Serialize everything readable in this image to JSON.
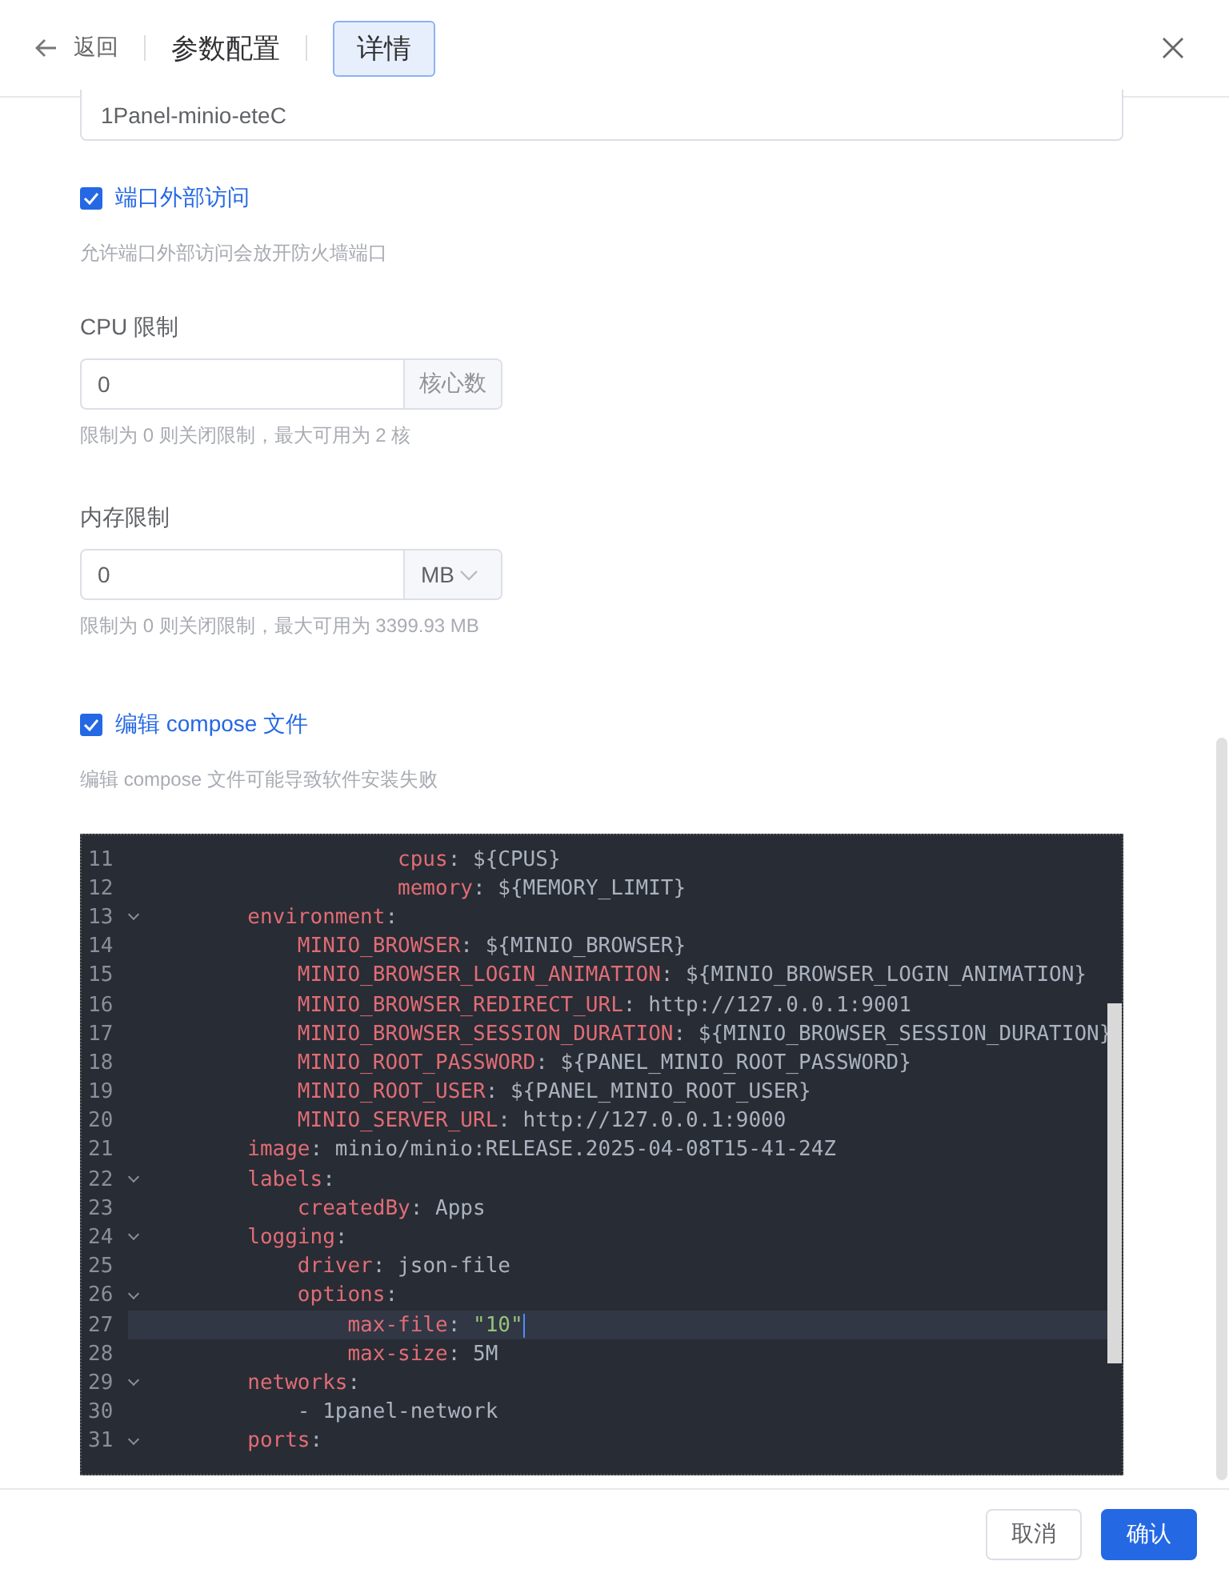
{
  "header": {
    "back": "返回",
    "tabs": [
      {
        "label": "参数配置",
        "selected": false
      },
      {
        "label": "详情",
        "selected": true
      }
    ]
  },
  "container_name": {
    "value": "1Panel-minio-eteC"
  },
  "port_access": {
    "label": "端口外部访问",
    "checked": true,
    "hint": "允许端口外部访问会放开防火墙端口"
  },
  "cpu": {
    "label": "CPU 限制",
    "value": "0",
    "unit": "核心数",
    "kind": "text",
    "hint": "限制为 0 则关闭限制，最大可用为 2 核"
  },
  "memory": {
    "label": "内存限制",
    "value": "0",
    "unit": "MB",
    "kind": "select",
    "hint": "限制为 0 则关闭限制，最大可用为 3399.93 MB"
  },
  "edit_compose": {
    "label": "编辑 compose 文件",
    "checked": true,
    "hint": "编辑 compose 文件可能导致软件安装失败"
  },
  "editor": {
    "lines": [
      {
        "no": "11",
        "fold": false,
        "current": false,
        "key": "                    cpus",
        "value": ": ${CPUS}",
        "kind": "plain"
      },
      {
        "no": "12",
        "fold": false,
        "current": false,
        "key": "                    memory",
        "value": ": ${MEMORY_LIMIT}",
        "kind": "plain"
      },
      {
        "no": "13",
        "fold": true,
        "current": false,
        "key": "        environment",
        "value": ":",
        "kind": "plain"
      },
      {
        "no": "14",
        "fold": false,
        "current": false,
        "key": "            MINIO_BROWSER",
        "value": ": ${MINIO_BROWSER}",
        "kind": "plain"
      },
      {
        "no": "15",
        "fold": false,
        "current": false,
        "key": "            MINIO_BROWSER_LOGIN_ANIMATION",
        "value": ": ${MINIO_BROWSER_LOGIN_ANIMATION}",
        "kind": "plain"
      },
      {
        "no": "16",
        "fold": false,
        "current": false,
        "key": "            MINIO_BROWSER_REDIRECT_URL",
        "value": ": http://127.0.0.1:9001",
        "kind": "plain"
      },
      {
        "no": "17",
        "fold": false,
        "current": false,
        "key": "            MINIO_BROWSER_SESSION_DURATION",
        "value": ": ${MINIO_BROWSER_SESSION_DURATION}",
        "kind": "plain"
      },
      {
        "no": "18",
        "fold": false,
        "current": false,
        "key": "            MINIO_ROOT_PASSWORD",
        "value": ": ${PANEL_MINIO_ROOT_PASSWORD}",
        "kind": "plain"
      },
      {
        "no": "19",
        "fold": false,
        "current": false,
        "key": "            MINIO_ROOT_USER",
        "value": ": ${PANEL_MINIO_ROOT_USER}",
        "kind": "plain"
      },
      {
        "no": "20",
        "fold": false,
        "current": false,
        "key": "            MINIO_SERVER_URL",
        "value": ": http://127.0.0.1:9000",
        "kind": "plain"
      },
      {
        "no": "21",
        "fold": false,
        "current": false,
        "key": "        image",
        "value": ": minio/minio:RELEASE.2025-04-08T15-41-24Z",
        "kind": "plain"
      },
      {
        "no": "22",
        "fold": true,
        "current": false,
        "key": "        labels",
        "value": ":",
        "kind": "plain"
      },
      {
        "no": "23",
        "fold": false,
        "current": false,
        "key": "            createdBy",
        "value": ": Apps",
        "kind": "plain"
      },
      {
        "no": "24",
        "fold": true,
        "current": false,
        "key": "        logging",
        "value": ":",
        "kind": "plain"
      },
      {
        "no": "25",
        "fold": false,
        "current": false,
        "key": "            driver",
        "value": ": json-file",
        "kind": "plain"
      },
      {
        "no": "26",
        "fold": true,
        "current": false,
        "key": "            options",
        "value": ":",
        "kind": "plain"
      },
      {
        "no": "27",
        "fold": false,
        "current": true,
        "key": "                max-file",
        "value": ": \"10\"",
        "kind": "string"
      },
      {
        "no": "28",
        "fold": false,
        "current": false,
        "key": "                max-size",
        "value": ": 5M",
        "kind": "plain"
      },
      {
        "no": "29",
        "fold": true,
        "current": false,
        "key": "        networks",
        "value": ":",
        "kind": "plain"
      },
      {
        "no": "30",
        "fold": false,
        "current": false,
        "value": "            - 1panel-network",
        "kind": "plain"
      },
      {
        "no": "31",
        "fold": true,
        "current": false,
        "key": "        ports",
        "value": ":",
        "kind": "plain"
      }
    ]
  },
  "footer": {
    "buttons": [
      {
        "label": "取消",
        "kind": "default"
      },
      {
        "label": "确认",
        "kind": "primary"
      }
    ]
  }
}
